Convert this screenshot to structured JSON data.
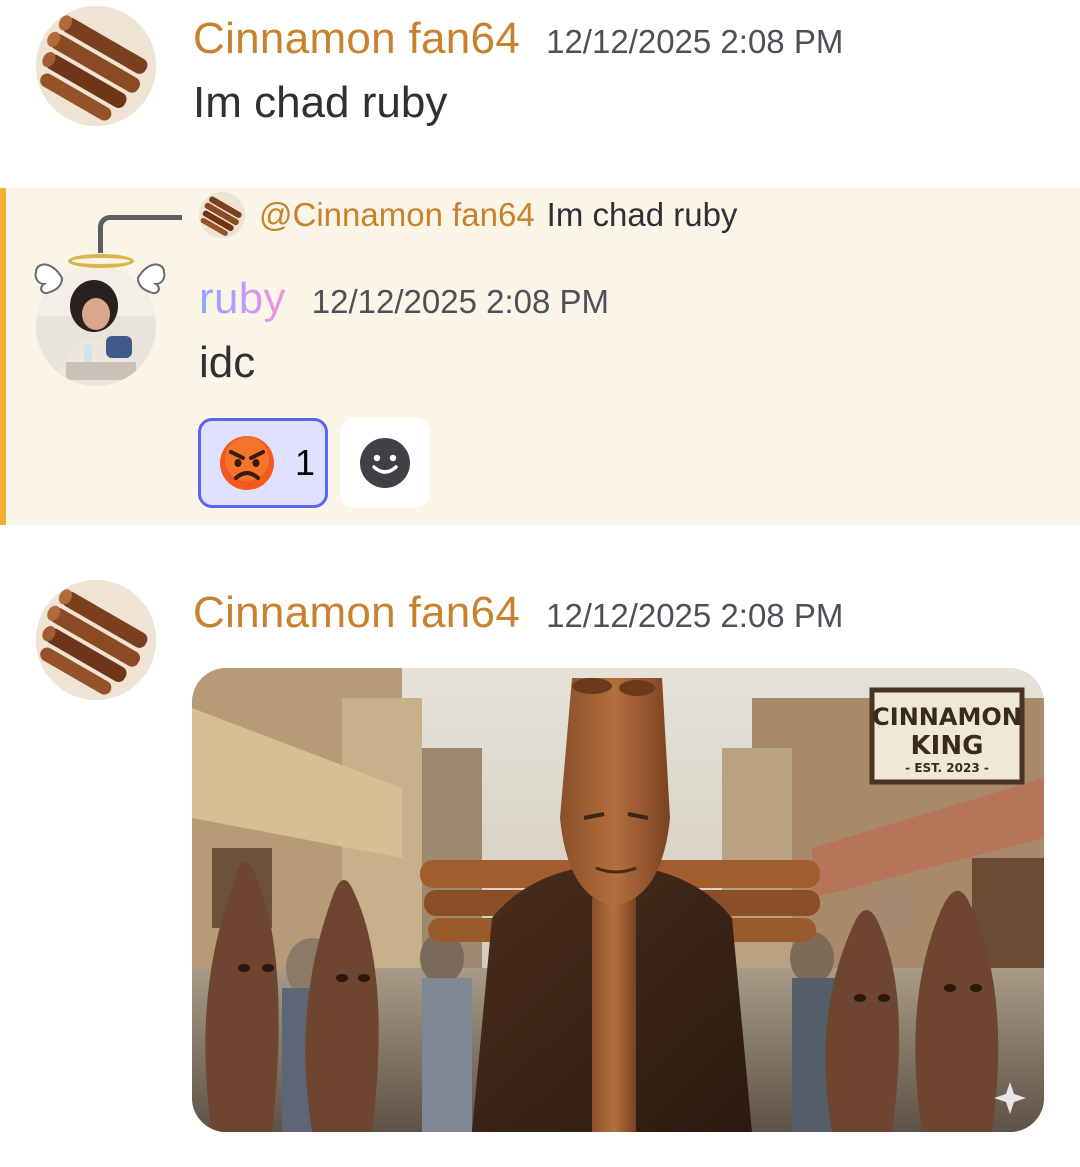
{
  "colors": {
    "cinnamon_username": "#c8822e",
    "mention_highlight_bg": "#fbf5e8",
    "mention_bar": "#f0b232",
    "reaction_active_border": "#5865f2",
    "reaction_active_bg": "#dee0fc"
  },
  "messages": [
    {
      "author": "Cinnamon fan64",
      "timestamp": "12/12/2025 2:08 PM",
      "content": "Im chad ruby",
      "avatar_icon": "cinnamon-sticks-avatar"
    },
    {
      "reply_to": {
        "author": "@Cinnamon fan64",
        "content": "Im chad ruby"
      },
      "author": "ruby",
      "timestamp": "12/12/2025 2:08 PM",
      "content": "idc",
      "avatar_icon": "photo-avatar-with-halo",
      "reactions": [
        {
          "emoji": "angry-face-emoji",
          "count": "1",
          "active": true
        }
      ],
      "add_reaction_icon": "smiley-add-reaction-icon"
    },
    {
      "author": "Cinnamon fan64",
      "timestamp": "12/12/2025 2:08 PM",
      "avatar_icon": "cinnamon-sticks-avatar",
      "attachment": {
        "type": "image",
        "sign_line1": "CINNAMON",
        "sign_line2": "KING",
        "sign_line3": "- EST. 2023 -",
        "sparkle_icon": "ai-sparkle-icon"
      }
    }
  ]
}
